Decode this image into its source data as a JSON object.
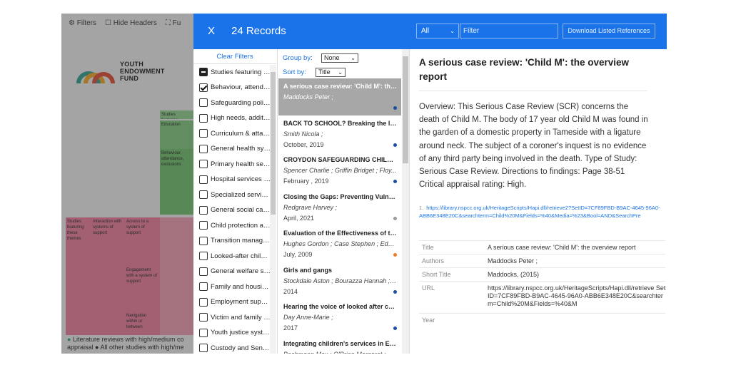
{
  "background": {
    "toolbar": {
      "filters": "Filters",
      "hide_headers": "Hide Headers",
      "full": "Fu"
    },
    "logo": {
      "line1": "YOUTH",
      "line2": "ENDOWMENT",
      "line3": "FUND"
    },
    "cells": {
      "studies_featuring": "Studies featuring these themes",
      "interaction": "Interaction with systems of support",
      "access": "Access to a system of support",
      "engagement": "Engagement with a system of support",
      "navigation": "Navigation within or between",
      "education": "Education",
      "studies_feat_short": "Studies featuring",
      "behaviour": "Behaviour, attendance, exclusions"
    },
    "legend": {
      "line1": "Literature reviews with high/medium co",
      "line2": "appraisal",
      "line3": "All other studies with high/me"
    }
  },
  "header": {
    "close": "X",
    "records": "24 Records",
    "all_select": "All",
    "filter_placeholder": "Filter",
    "download": "Download Listed References"
  },
  "filters": {
    "clear": "Clear Filters",
    "items": [
      {
        "label": "Studies featuring thes...",
        "state": "partial"
      },
      {
        "label": "Behaviour, attendan...",
        "state": "checked"
      },
      {
        "label": "Safeguarding polici...",
        "state": "unchecked"
      },
      {
        "label": "High needs, additio...",
        "state": "unchecked"
      },
      {
        "label": "Curriculum & attain...",
        "state": "unchecked"
      },
      {
        "label": "General health syst...",
        "state": "unchecked"
      },
      {
        "label": "Primary health servi...",
        "state": "unchecked"
      },
      {
        "label": "Hospital services in...",
        "state": "unchecked"
      },
      {
        "label": "Specialized service...",
        "state": "unchecked"
      },
      {
        "label": "General social care ...",
        "state": "unchecked"
      },
      {
        "label": "Child protection an...",
        "state": "unchecked"
      },
      {
        "label": "Transition manage...",
        "state": "unchecked"
      },
      {
        "label": "Looked-after childre...",
        "state": "unchecked"
      },
      {
        "label": "General welfare sys...",
        "state": "unchecked"
      },
      {
        "label": "Family and housing ...",
        "state": "unchecked"
      },
      {
        "label": "Employment suppo...",
        "state": "unchecked"
      },
      {
        "label": "Victim and family s...",
        "state": "unchecked"
      },
      {
        "label": "Youth justice system",
        "state": "unchecked"
      },
      {
        "label": "Custody and Senten...",
        "state": "unchecked"
      }
    ]
  },
  "records": {
    "group_by_label": "Group by:",
    "group_by_value": "None",
    "sort_by_label": "Sort by:",
    "sort_by_value": "Title",
    "items": [
      {
        "title": "A serious case review: 'Child M': the ...",
        "authors": "Maddocks Peter ;",
        "date": "",
        "dot": "#1a4fa0",
        "selected": true
      },
      {
        "title": "BACK TO SCHOOL? Breaking the link...",
        "authors": "Smith Nicola ;",
        "date": "October, 2019",
        "dot": "#1a4fa0",
        "selected": false
      },
      {
        "title": "CROYDON SAFEGUARDING CHILDRE...",
        "authors": "Spencer Charlie ; Griffin Bridget ; Floy...",
        "date": "February , 2019",
        "dot": "#1a4fa0",
        "selected": false
      },
      {
        "title": "Closing the Gaps: Preventing Vulner...",
        "authors": "Redgrave Harvey ;",
        "date": "April, 2021",
        "dot": "#9a9a9a",
        "selected": false
      },
      {
        "title": "Evaluation of the Effectiveness of th...",
        "authors": "Hughes Gordon ; Case Stephen ; Edw...",
        "date": "July, 2009",
        "dot": "#f07b2c",
        "selected": false
      },
      {
        "title": "Girls and gangs",
        "authors": "Stockdale Aston ; Bourazza Hannah ; ...",
        "date": "2014",
        "dot": "#1a4fa0",
        "selected": false
      },
      {
        "title": "Hearing the voice of looked after chil...",
        "authors": "Day Anne-Marie ;",
        "date": "2017",
        "dot": "#1a4fa0",
        "selected": false
      },
      {
        "title": "Integrating children's services in Eng...",
        "authors": "Bachmann Max ; O'Brien Margaret ; H...",
        "date": "",
        "dot": "",
        "selected": false
      }
    ]
  },
  "detail": {
    "title": "A serious case review: 'Child M': the overview report",
    "body": "Overview: This Serious Case Review (SCR) concerns the death of Child M. The body of 17 year old Child M was found in the garden of a domestic property in Tameside with a ligature around neck. The subject of a coroner's inquest is no evidence of any third party being involved in the death. Type of Study: Serious Case Review. Directions to findings: Page 38-51 Critical appraisal rating: High.",
    "link_number": "1.",
    "link": "https://library.nspcc.org.uk/HeritageScripts/Hapi.dll/retrieve2?SetID=7CF89FBD-B9AC-4645-96A0-ABB6E348E20C&searchterm=Child%20M&Fields=%40&Media=%23&Bool=AND&SearchPre",
    "fields": [
      {
        "key": "Title",
        "value": "A serious case review: 'Child M': the overview report"
      },
      {
        "key": "Authors",
        "value": "Maddocks Peter ;"
      },
      {
        "key": "Short Title",
        "value": "Maddocks, (2015)"
      },
      {
        "key": "URL",
        "value": "https://library.nspcc.org.uk/HeritageScripts/Hapi.dll/retrieve SetID=7CF89FBD-B9AC-4645-96A0-ABB6E348E20C&searchterm=Child%20M&Fields=%40&M"
      },
      {
        "key": "Year",
        "value": ""
      }
    ]
  }
}
